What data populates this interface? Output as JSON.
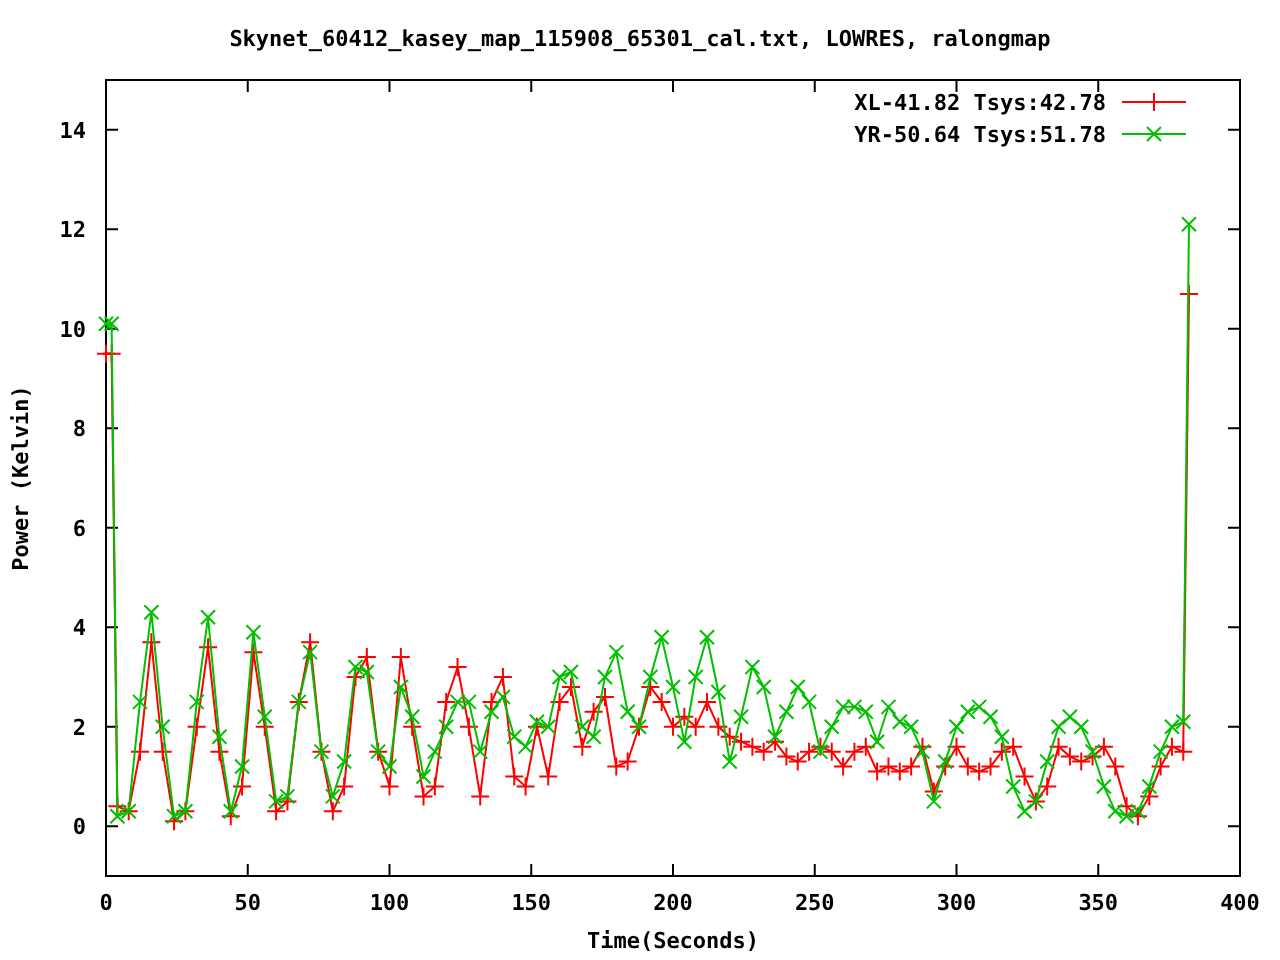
{
  "chart_data": {
    "type": "line",
    "title": "Skynet_60412_kasey_map_115908_65301_cal.txt, LOWRES, ralongmap",
    "xlabel": "Time(Seconds)",
    "ylabel": "Power (Kelvin)",
    "xlim": [
      0,
      400
    ],
    "ylim": [
      -1,
      15
    ],
    "xticks": [
      0,
      50,
      100,
      150,
      200,
      250,
      300,
      350,
      400
    ],
    "yticks": [
      0,
      2,
      4,
      6,
      8,
      10,
      12,
      14
    ],
    "legend": true,
    "x": [
      0,
      2,
      4,
      8,
      12,
      16,
      20,
      24,
      28,
      32,
      36,
      40,
      44,
      48,
      52,
      56,
      60,
      64,
      68,
      72,
      76,
      80,
      84,
      88,
      92,
      96,
      100,
      104,
      108,
      112,
      116,
      120,
      124,
      128,
      132,
      136,
      140,
      144,
      148,
      152,
      156,
      160,
      164,
      168,
      172,
      176,
      180,
      184,
      188,
      192,
      196,
      200,
      204,
      208,
      212,
      216,
      220,
      224,
      228,
      232,
      236,
      240,
      244,
      248,
      252,
      256,
      260,
      264,
      268,
      272,
      276,
      280,
      284,
      288,
      292,
      296,
      300,
      304,
      308,
      312,
      316,
      320,
      324,
      328,
      332,
      336,
      340,
      344,
      348,
      352,
      356,
      360,
      364,
      368,
      372,
      376,
      380,
      382
    ],
    "series": [
      {
        "name": "XL-41.82 Tsys:42.78",
        "color": "#ff0000",
        "marker": "plus",
        "values": [
          9.5,
          9.5,
          0.4,
          0.3,
          1.5,
          3.7,
          1.5,
          0.1,
          0.3,
          2.0,
          3.6,
          1.5,
          0.2,
          0.8,
          3.5,
          2.0,
          0.3,
          0.5,
          2.5,
          3.7,
          1.5,
          0.3,
          0.8,
          3.0,
          3.4,
          1.5,
          0.8,
          3.4,
          2.0,
          0.6,
          0.8,
          2.5,
          3.2,
          2.0,
          0.6,
          2.5,
          3.0,
          1.0,
          0.8,
          2.0,
          1.0,
          2.5,
          2.8,
          1.6,
          2.3,
          2.6,
          1.2,
          1.3,
          2.0,
          2.8,
          2.5,
          2.0,
          2.2,
          2.0,
          2.5,
          2.0,
          1.8,
          1.7,
          1.6,
          1.5,
          1.7,
          1.4,
          1.3,
          1.5,
          1.6,
          1.5,
          1.2,
          1.5,
          1.6,
          1.1,
          1.2,
          1.1,
          1.2,
          1.6,
          0.7,
          1.2,
          1.6,
          1.2,
          1.1,
          1.2,
          1.5,
          1.6,
          1.0,
          0.5,
          0.8,
          1.6,
          1.4,
          1.3,
          1.4,
          1.6,
          1.2,
          0.4,
          0.2,
          0.6,
          1.2,
          1.6,
          1.5,
          10.7
        ]
      },
      {
        "name": "YR-50.64 Tsys:51.78",
        "color": "#00c000",
        "marker": "cross",
        "values": [
          10.1,
          10.1,
          0.2,
          0.3,
          2.5,
          4.3,
          2.0,
          0.2,
          0.3,
          2.5,
          4.2,
          1.8,
          0.3,
          1.2,
          3.9,
          2.2,
          0.5,
          0.6,
          2.5,
          3.5,
          1.5,
          0.6,
          1.3,
          3.2,
          3.1,
          1.5,
          1.2,
          2.8,
          2.2,
          1.0,
          1.5,
          2.0,
          2.5,
          2.5,
          1.5,
          2.3,
          2.6,
          1.8,
          1.6,
          2.1,
          2.0,
          3.0,
          3.1,
          2.0,
          1.8,
          3.0,
          3.5,
          2.3,
          2.0,
          3.0,
          3.8,
          2.8,
          1.7,
          3.0,
          3.8,
          2.7,
          1.3,
          2.2,
          3.2,
          2.8,
          1.8,
          2.3,
          2.8,
          2.5,
          1.5,
          2.0,
          2.4,
          2.4,
          2.3,
          1.7,
          2.4,
          2.1,
          2.0,
          1.5,
          0.5,
          1.3,
          2.0,
          2.3,
          2.4,
          2.2,
          1.8,
          0.8,
          0.3,
          0.5,
          1.3,
          2.0,
          2.2,
          2.0,
          1.5,
          0.8,
          0.3,
          0.2,
          0.3,
          0.8,
          1.5,
          2.0,
          2.1,
          12.1
        ]
      }
    ]
  }
}
